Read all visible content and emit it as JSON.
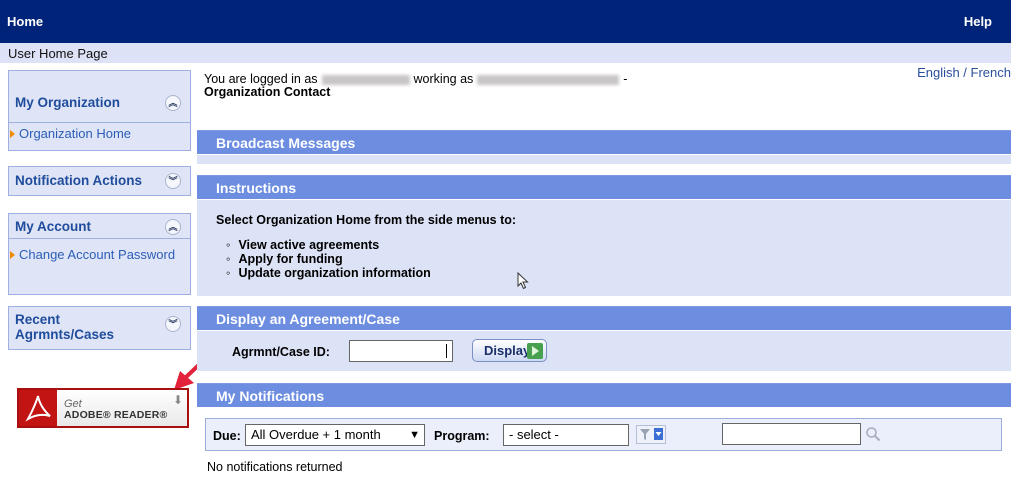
{
  "topbar": {
    "home": "Home",
    "help": "Help"
  },
  "subbar": {
    "title": "User Home Page"
  },
  "language": {
    "label": "English / French"
  },
  "login": {
    "prefix": "You are logged in as",
    "working_as": "working as",
    "dash": "-",
    "role": "Organization Contact"
  },
  "sidebar": {
    "my_organization": {
      "title": "My Organization",
      "items": [
        {
          "label": "Organization Home"
        }
      ]
    },
    "notification_actions": {
      "title": "Notification Actions"
    },
    "my_account": {
      "title": "My Account",
      "items": [
        {
          "label": "Change Account Password"
        }
      ]
    },
    "recent": {
      "title": "Recent Agrmnts/Cases"
    }
  },
  "adobe": {
    "get": "Get",
    "name": "ADOBE® READER®"
  },
  "broadcast": {
    "title": "Broadcast Messages"
  },
  "instructions": {
    "title": "Instructions",
    "text": "Select Organization Home from the side menus to:",
    "items": [
      "View active agreements",
      "Apply for funding",
      "Update organization information"
    ]
  },
  "display": {
    "title": "Display an Agreement/Case",
    "id_label": "Agrmnt/Case ID:",
    "id_value": "",
    "button_label": "Display"
  },
  "notifications": {
    "title": "My Notifications",
    "due_label": "Due:",
    "due_value": "All Overdue + 1 month",
    "program_label": "Program:",
    "program_value": "- select -",
    "search_value": "",
    "empty_text": "No notifications returned"
  },
  "colors": {
    "topbar": "#00237a",
    "panel_header": "#6d8ee0",
    "link": "#2b5db8",
    "accent_arrow": "#e2213a"
  }
}
